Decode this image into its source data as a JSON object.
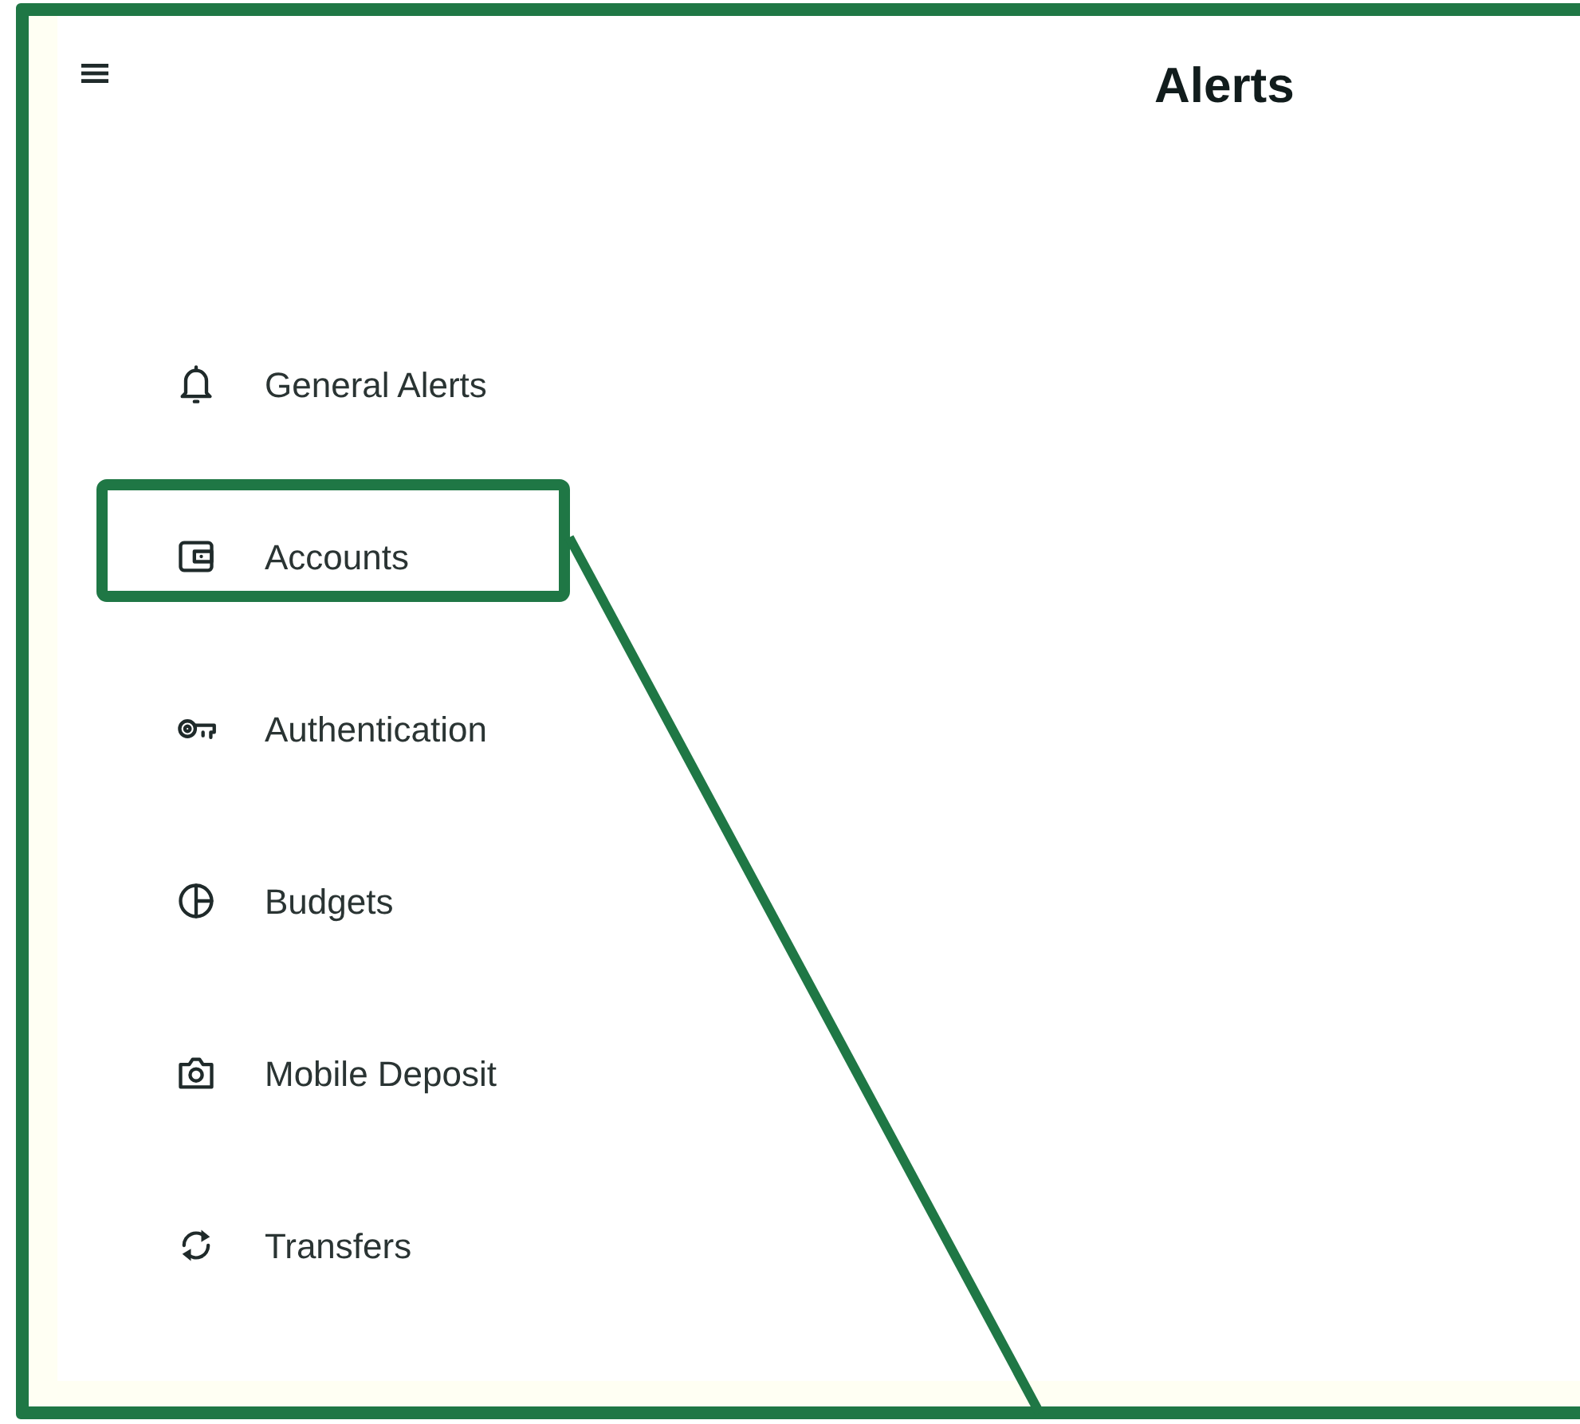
{
  "header": {
    "title": "Alerts"
  },
  "menu": [
    {
      "label": "General Alerts",
      "kind": "bell"
    },
    {
      "label": "Accounts",
      "kind": "wallet"
    },
    {
      "label": "Authentication",
      "kind": "key"
    },
    {
      "label": "Budgets",
      "kind": "pie"
    },
    {
      "label": "Mobile Deposit",
      "kind": "camera"
    },
    {
      "label": "Transfers",
      "kind": "sync"
    }
  ]
}
